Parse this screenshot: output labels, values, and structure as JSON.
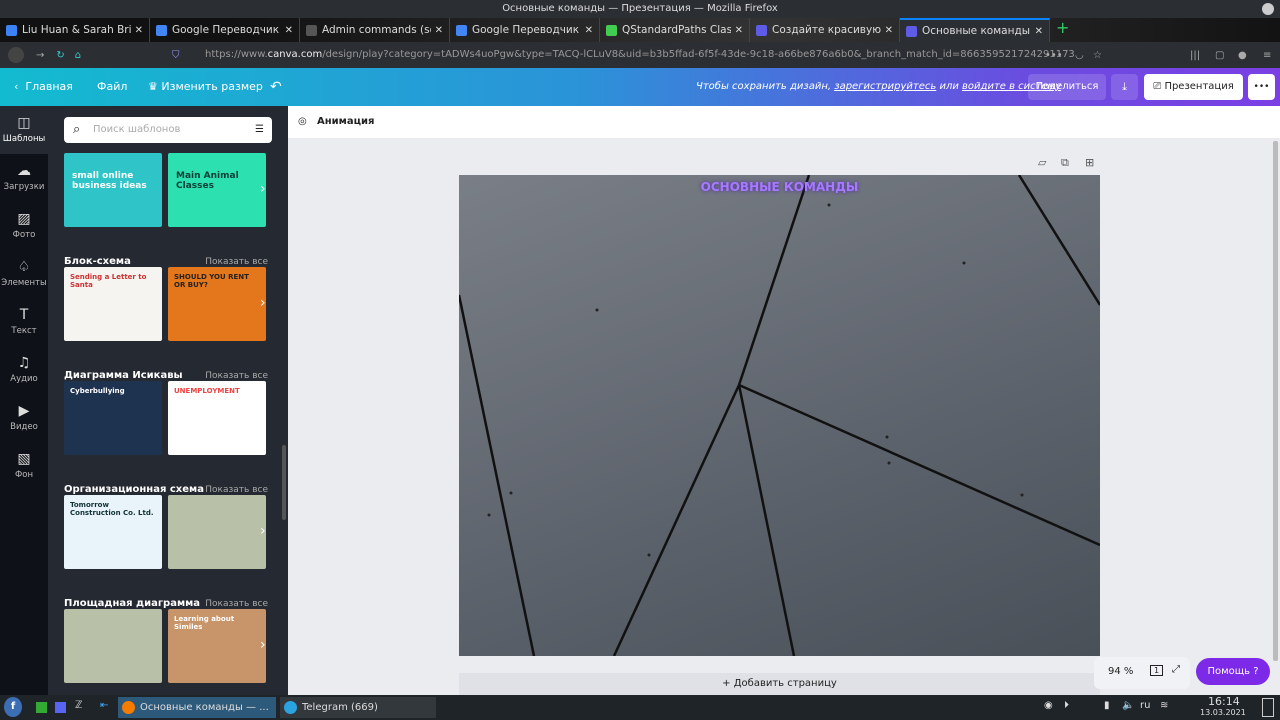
{
  "window_title": "Основные команды — Презентация — Mozilla Firefox",
  "tabs": [
    {
      "label": "Liu Huan & Sarah Bri",
      "color": "#3b82f6"
    },
    {
      "label": "Google Переводчик",
      "color": "#4285f4"
    },
    {
      "label": "Admin commands (sourcem",
      "color": "#555"
    },
    {
      "label": "Google Переводчик",
      "color": "#4285f4"
    },
    {
      "label": "QStandardPaths Class |",
      "color": "#41cd52"
    },
    {
      "label": "Создайте красивую та",
      "color": "#5e5ce6"
    },
    {
      "label": "Основные команды —",
      "color": "#5e5ce6"
    }
  ],
  "url_prefix": "https://www.",
  "url_domain": "canva.com",
  "url_rest": "/design/play?category=tADWs4uoPgw&type=TACQ-lCLuV8&uid=b3b5ffad-6f5f-43de-9c18-a66be876a6b0&_branch_match_id=866359521724291173",
  "header": {
    "home": "Главная",
    "file": "Файл",
    "resize": "Изменить размер",
    "save_prompt": "Чтобы сохранить дизайн,",
    "register": "зарегистрируйтесь",
    "or": "или",
    "login": "войдите в систему",
    "share": "Поделиться",
    "present": "Презентация",
    "more": "•••"
  },
  "rail": [
    "Шаблоны",
    "Загрузки",
    "Фото",
    "Элементы",
    "Текст",
    "Аудио",
    "Видео",
    "Фон"
  ],
  "search_placeholder": "Поиск шаблонов",
  "show_all": "Показать все",
  "sections": [
    {
      "title": "",
      "thumbs": [
        "small online business ideas",
        "Main Animal Classes"
      ]
    },
    {
      "title": "Блок-схема",
      "thumbs": [
        "Sending a Letter to Santa",
        "SHOULD YOU RENT OR BUY?"
      ]
    },
    {
      "title": "Диаграмма Исикавы",
      "thumbs": [
        "Cyberbullying",
        "UNEMPLOYMENT"
      ]
    },
    {
      "title": "Организационная схема",
      "thumbs": [
        "Tomorrow Construction Co. Ltd.",
        ""
      ]
    },
    {
      "title": "Площадная диаграмма",
      "thumbs": [
        "",
        "Learning about Similes"
      ]
    }
  ],
  "animation": "Анимация",
  "slide_title": "ОСНОВНЫЕ КОМАНДЫ",
  "add_page": "+ Добавить страницу",
  "zoom": "94 %",
  "page_count": "1",
  "help": "Помощь ?",
  "taskbar": {
    "firefox": "Основные команды — ...",
    "telegram": "Telegram (669)",
    "lang": "ru",
    "time": "16:14",
    "date": "13.03.2021"
  }
}
